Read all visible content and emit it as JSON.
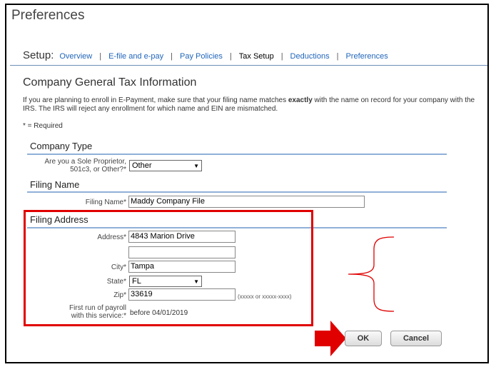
{
  "window": {
    "title": "Preferences"
  },
  "setup": {
    "label": "Setup:",
    "tabs": [
      {
        "label": "Overview"
      },
      {
        "label": "E-file and e-pay"
      },
      {
        "label": "Pay Policies"
      },
      {
        "label": "Tax Setup"
      },
      {
        "label": "Deductions"
      },
      {
        "label": "Preferences"
      }
    ],
    "separator": "|"
  },
  "page": {
    "title": "Company General Tax Information",
    "intro_before": "If you are planning to enroll in E-Payment, make sure that your filing name matches ",
    "intro_bold": "exactly",
    "intro_after": " with the name on record for your company with the IRS. The IRS will reject any enrollment for which name and EIN are mismatched.",
    "required_note": "* = Required"
  },
  "company_type": {
    "heading": "Company Type",
    "question_line1": "Are you a Sole Proprietor,",
    "question_line2": "501c3, or Other?*",
    "selected": "Other"
  },
  "filing_name": {
    "heading": "Filing Name",
    "label": "Filing Name*",
    "value": "Maddy Company File"
  },
  "filing_address": {
    "heading": "Filing Address",
    "address_label": "Address*",
    "address_line1": "4843  Marion Drive",
    "address_line2": "",
    "city_label": "City*",
    "city": "Tampa",
    "state_label": "State*",
    "state": "FL",
    "zip_label": "Zip*",
    "zip": "33619",
    "zip_hint": "(xxxxx or xxxxx-xxxx)",
    "first_run_label_line1": "First run of payroll",
    "first_run_label_line2": "with this service:*",
    "first_run_value": "before 04/01/2019"
  },
  "buttons": {
    "ok": "OK",
    "cancel": "Cancel"
  },
  "colors": {
    "annotation_red": "#e00000",
    "link_blue": "#2266bb",
    "rule_blue": "#8fb0d8"
  }
}
